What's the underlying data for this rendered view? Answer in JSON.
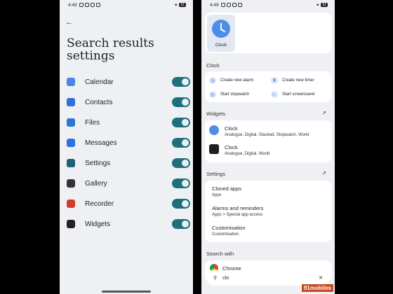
{
  "left": {
    "status": {
      "time": "4:49",
      "battery": "61"
    },
    "title_line1": "Search results",
    "title_line2": "settings",
    "settings": [
      {
        "label": "Calendar",
        "icon": "calendar-icon",
        "color": "#4a86e8",
        "enabled": true
      },
      {
        "label": "Contacts",
        "icon": "contacts-icon",
        "color": "#2f6fdc",
        "enabled": true
      },
      {
        "label": "Files",
        "icon": "files-icon",
        "color": "#2e75d6",
        "enabled": true
      },
      {
        "label": "Messages",
        "icon": "messages-icon",
        "color": "#2f6fe0",
        "enabled": true
      },
      {
        "label": "Settings",
        "icon": "settings-icon",
        "color": "#1c6277",
        "enabled": true
      },
      {
        "label": "Gallery",
        "icon": "gallery-icon",
        "color": "#333333",
        "enabled": true
      },
      {
        "label": "Recorder",
        "icon": "recorder-icon",
        "color": "#d33b2f",
        "enabled": true
      },
      {
        "label": "Widgets",
        "icon": "widgets-icon",
        "color": "#222222",
        "enabled": true
      }
    ]
  },
  "right": {
    "status": {
      "time": "4:49",
      "battery": "61"
    },
    "app_result": {
      "label": "Clock"
    },
    "clock_section": {
      "title": "Clock",
      "actions": [
        "Create new alarm",
        "Create new timer",
        "Start stopwatch",
        "Start screensaver"
      ]
    },
    "widgets_section": {
      "title": "Widgets",
      "items": [
        {
          "title": "Clock",
          "sub": "Analogue, Digital, Stacked, Stopwatch, World"
        },
        {
          "title": "Clock",
          "sub": "Analogue, Digital, World"
        }
      ]
    },
    "settings_section": {
      "title": "Settings",
      "items": [
        {
          "title": "Cloned apps",
          "sub": "Apps"
        },
        {
          "title": "Alarms and reminders",
          "sub": "Apps > Special app access"
        },
        {
          "title": "Customisation",
          "sub": "Customisation"
        }
      ]
    },
    "search_with": {
      "title": "Search with",
      "item": "Chrome"
    },
    "search": {
      "query": "clo"
    },
    "watermark": "91mobiles"
  }
}
